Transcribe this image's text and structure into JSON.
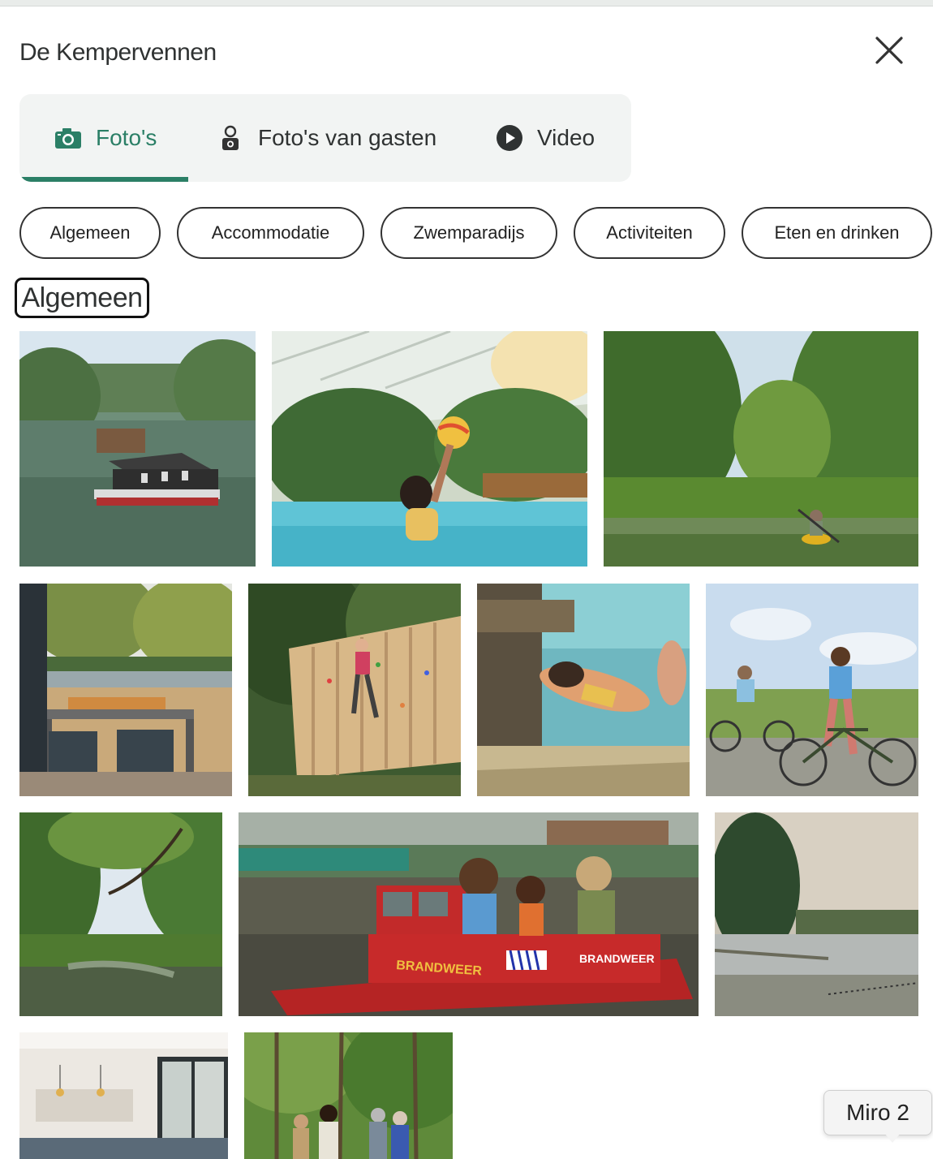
{
  "modal": {
    "title": "De Kempervennen"
  },
  "tabs": [
    {
      "label": "Foto's",
      "icon": "camera-icon",
      "active": true
    },
    {
      "label": "Foto's van gasten",
      "icon": "guest-camera-icon",
      "active": false
    },
    {
      "label": "Video",
      "icon": "play-icon",
      "active": false
    }
  ],
  "filters": [
    "Algemeen",
    "Accommodatie",
    "Zwemparadijs",
    "Activiteiten",
    "Eten en drinken"
  ],
  "section": {
    "heading": "Algemeen"
  },
  "photos": [
    {
      "subject": "houseboat on lake"
    },
    {
      "subject": "girl with ball in pool"
    },
    {
      "subject": "kayaker on river"
    },
    {
      "subject": "terrace breakfast by lake"
    },
    {
      "subject": "climbing wall"
    },
    {
      "subject": "child swimming underwater"
    },
    {
      "subject": "cyclists on path"
    },
    {
      "subject": "tree canopy over creek"
    },
    {
      "subject": "brandweer boat ride"
    },
    {
      "subject": "lake with pine tree"
    },
    {
      "subject": "cottage interior"
    },
    {
      "subject": "family walking in forest"
    }
  ],
  "boat_text": "BRANDWEER",
  "tooltip": {
    "label": "Miro 2"
  },
  "colors": {
    "accent": "#2b7f66",
    "tab_bg": "#f2f4f3"
  }
}
